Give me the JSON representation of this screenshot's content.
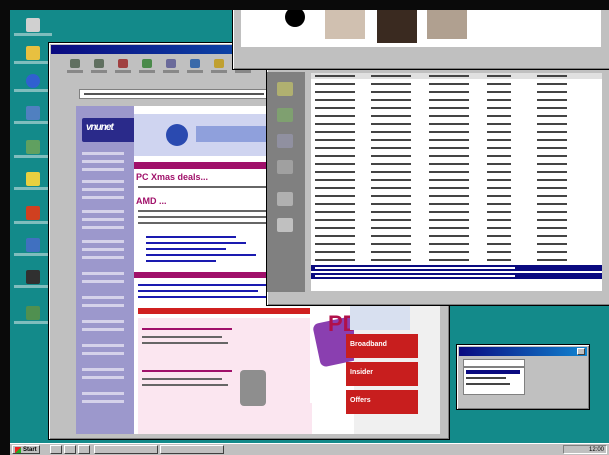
{
  "desktop": {
    "icons": [
      {
        "name": "my-computer-icon",
        "color": "#d0d0d0"
      },
      {
        "name": "my-documents-icon",
        "color": "#e8c040"
      },
      {
        "name": "internet-explorer-icon",
        "color": "#3060d0"
      },
      {
        "name": "network-icon",
        "color": "#5080c0"
      },
      {
        "name": "recycle-bin-icon",
        "color": "#60a060"
      },
      {
        "name": "folder-icon",
        "color": "#e8d040"
      },
      {
        "name": "outlook-icon",
        "color": "#d04020"
      },
      {
        "name": "setup-icon",
        "color": "#4070c0"
      },
      {
        "name": "program-icon",
        "color": "#303030"
      },
      {
        "name": "shortcut-icon",
        "color": "#509050"
      }
    ]
  },
  "browser": {
    "page": {
      "logo": "vnunet",
      "headline_1": "PC Xmas deals...",
      "headline_2": "AMD ...",
      "pda_label": "PDA",
      "ads": [
        "Broadband",
        "Insider",
        "Offers"
      ]
    }
  },
  "file_manager": {},
  "dialog": {},
  "taskbar": {
    "start_label": "Start",
    "clock": "12:00"
  }
}
